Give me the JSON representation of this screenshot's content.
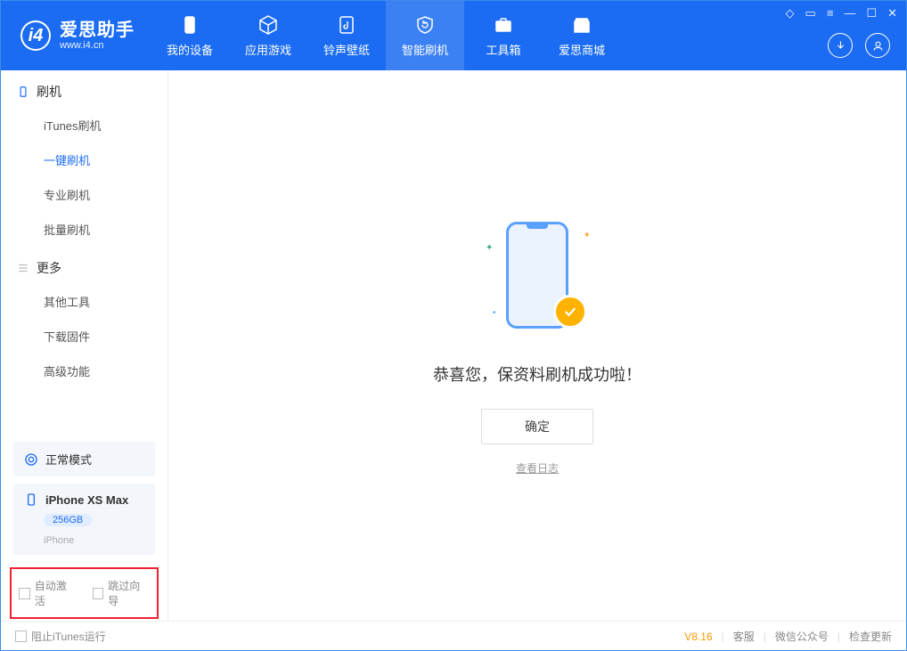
{
  "app": {
    "title": "爱思助手",
    "subtitle": "www.i4.cn"
  },
  "header_tabs": [
    {
      "label": "我的设备"
    },
    {
      "label": "应用游戏"
    },
    {
      "label": "铃声壁纸"
    },
    {
      "label": "智能刷机"
    },
    {
      "label": "工具箱"
    },
    {
      "label": "爱思商城"
    }
  ],
  "sidebar": {
    "group1_title": "刷机",
    "group1_items": [
      "iTunes刷机",
      "一键刷机",
      "专业刷机",
      "批量刷机"
    ],
    "group2_title": "更多",
    "group2_items": [
      "其他工具",
      "下载固件",
      "高级功能"
    ]
  },
  "device_mode": {
    "label": "正常模式"
  },
  "device": {
    "name": "iPhone XS Max",
    "storage": "256GB",
    "type": "iPhone"
  },
  "options": {
    "auto_activate": "自动激活",
    "skip_guide": "跳过向导"
  },
  "main": {
    "success_msg": "恭喜您，保资料刷机成功啦！",
    "ok_btn": "确定",
    "view_log": "查看日志"
  },
  "footer": {
    "block_itunes": "阻止iTunes运行",
    "version": "V8.16",
    "support": "客服",
    "wechat": "微信公众号",
    "check_update": "检查更新"
  }
}
